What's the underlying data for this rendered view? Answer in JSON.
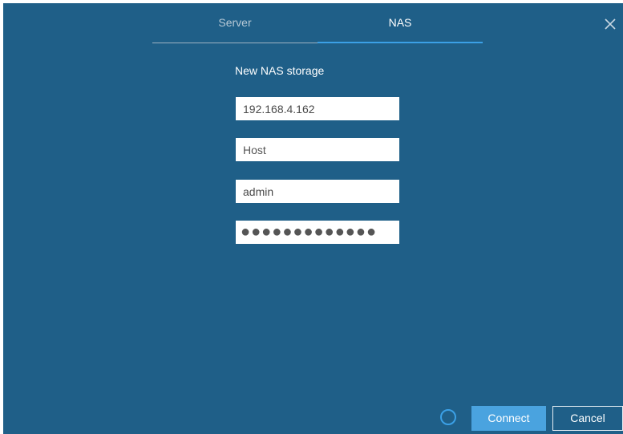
{
  "tabs": [
    {
      "label": "Server",
      "active": false
    },
    {
      "label": "NAS",
      "active": true
    }
  ],
  "form": {
    "title": "New NAS storage",
    "address": "192.168.4.162",
    "host": "Host",
    "username": "admin",
    "password": "●●●●●●●●●●●●●"
  },
  "buttons": {
    "connect": "Connect",
    "cancel": "Cancel"
  },
  "icons": {
    "close": "close-icon",
    "progress": "loading-spinner-icon"
  },
  "colors": {
    "background": "#1f5f88",
    "accent": "#3ba0e6",
    "connect_button": "#4aa3df"
  }
}
